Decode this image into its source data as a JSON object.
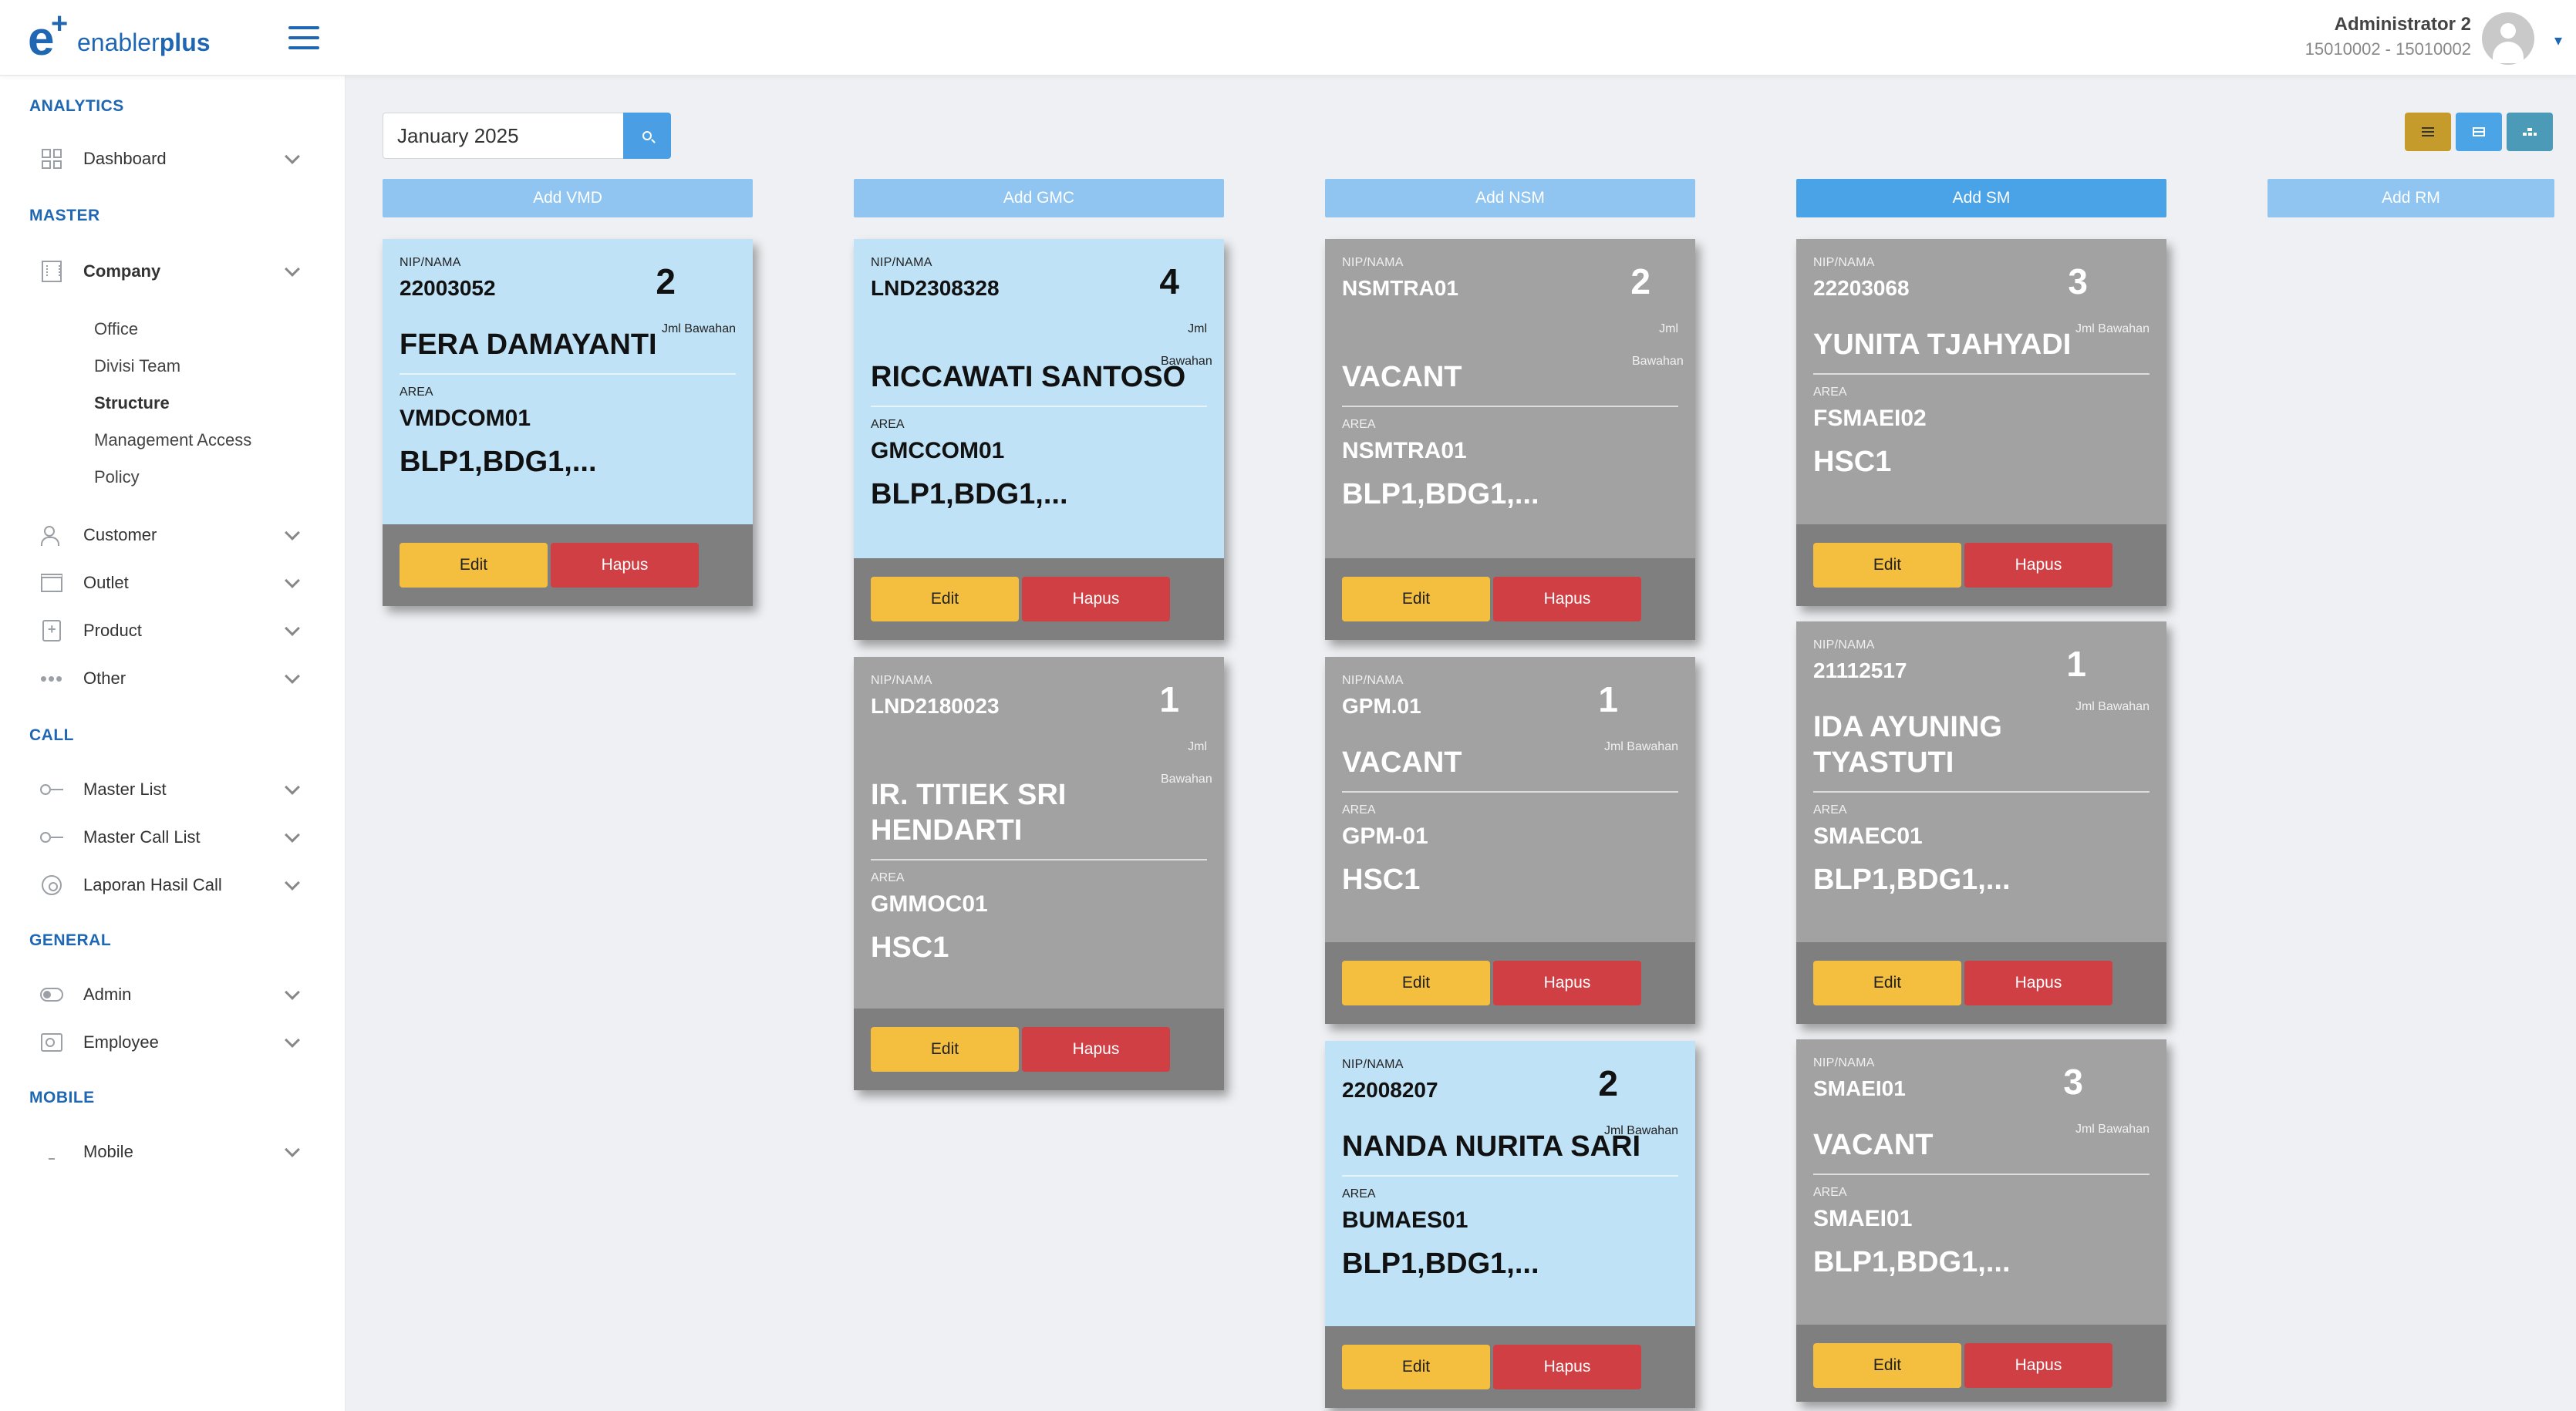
{
  "header": {
    "logo_text_light": "enabler",
    "logo_text_bold": "plus",
    "user_name": "Administrator 2",
    "user_id": "15010002 - 15010002"
  },
  "sidebar": {
    "sections": {
      "analytics": "ANALYTICS",
      "master": "MASTER",
      "call": "CALL",
      "general": "GENERAL",
      "mobile": "MOBILE"
    },
    "items": {
      "dashboard": "Dashboard",
      "company": "Company",
      "customer": "Customer",
      "outlet": "Outlet",
      "product": "Product",
      "other": "Other",
      "master_list": "Master List",
      "master_call_list": "Master Call List",
      "laporan_hasil_call": "Laporan Hasil Call",
      "admin": "Admin",
      "employee": "Employee",
      "mobile": "Mobile"
    },
    "company_sub": [
      "Office",
      "Divisi Team",
      "Structure",
      "Management Access",
      "Policy"
    ]
  },
  "toolbar": {
    "date_value": "January 2025"
  },
  "columns": [
    {
      "add_label": "Add VMD"
    },
    {
      "add_label": "Add GMC"
    },
    {
      "add_label": "Add NSM"
    },
    {
      "add_label": "Add SM"
    },
    {
      "add_label": "Add RM"
    }
  ],
  "labels": {
    "nip_nama": "NIP/NAMA",
    "jml_bawahan": "Jml Bawahan",
    "area": "AREA",
    "edit": "Edit",
    "hapus": "Hapus"
  },
  "cards": [
    {
      "nip": "22003052",
      "count": "2",
      "name": "FERA DAMAYANTI",
      "area_code": "VMDCOM01",
      "areas": "BLP1,BDG1,..."
    },
    {
      "nip": "LND2308328",
      "count": "4",
      "name": "RICCAWATI SANTOSO",
      "area_code": "GMCCOM01",
      "areas": "BLP1,BDG1,..."
    },
    {
      "nip": "LND2180023",
      "count": "1",
      "name": "IR. TITIEK SRI HENDARTI",
      "area_code": "GMMOC01",
      "areas": "HSC1"
    },
    {
      "nip": "NSMTRA01",
      "count": "2",
      "name": "VACANT",
      "area_code": "NSMTRA01",
      "areas": "BLP1,BDG1,..."
    },
    {
      "nip": "GPM.01",
      "count": "1",
      "name": "VACANT",
      "area_code": "GPM-01",
      "areas": "HSC1"
    },
    {
      "nip": "22008207",
      "count": "2",
      "name": "NANDA NURITA SARI",
      "area_code": "BUMAES01",
      "areas": "BLP1,BDG1,..."
    },
    {
      "nip": "22203068",
      "count": "3",
      "name": "YUNITA TJAHYADI",
      "area_code": "FSMAEI02",
      "areas": "HSC1"
    },
    {
      "nip": "21112517",
      "count": "1",
      "name": "IDA AYUNING TYASTUTI",
      "area_code": "SMAEC01",
      "areas": "BLP1,BDG1,..."
    },
    {
      "nip": "SMAEI01",
      "count": "3",
      "name": "VACANT",
      "area_code": "SMAEI01",
      "areas": "BLP1,BDG1,..."
    }
  ]
}
